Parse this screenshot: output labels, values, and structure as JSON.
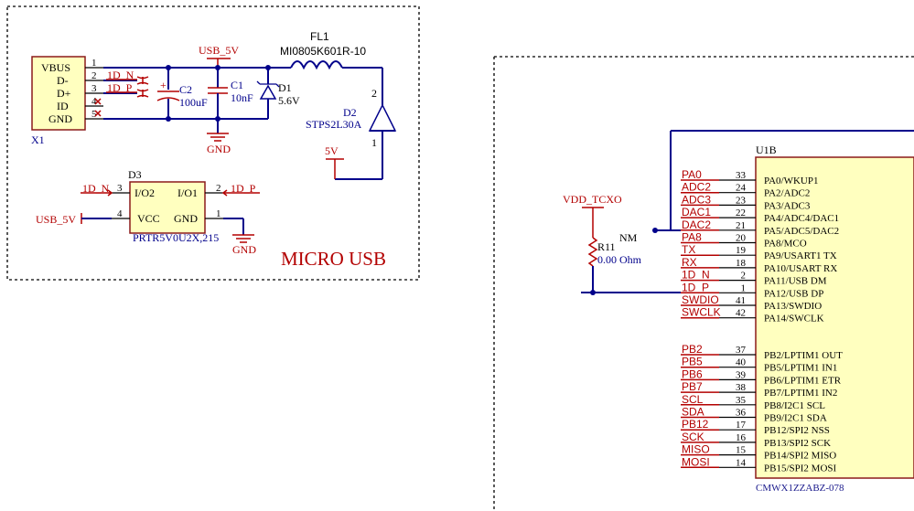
{
  "block_title": "MICRO USB",
  "usb_connector": {
    "ref": "X1",
    "pins": [
      {
        "name": "VBUS",
        "num": "1"
      },
      {
        "name": "D-",
        "num": "2"
      },
      {
        "name": "D+",
        "num": "3"
      },
      {
        "name": "ID",
        "num": "4"
      },
      {
        "name": "GND",
        "num": "5"
      }
    ]
  },
  "net_labels": {
    "usb_5v_top": "USB_5V",
    "usb_5v_left": "USB_5V",
    "net_5v": "5V",
    "d_n": "1D_N",
    "d_p": "1D_P",
    "d3_n": "1D_N",
    "d3_p": "1D_P",
    "gnd_c1": "GND",
    "gnd_d3": "GND",
    "vdd_tcxo": "VDD_TCXO"
  },
  "components": {
    "fl1": {
      "ref": "FL1",
      "value": "MI0805K601R-10"
    },
    "c2": {
      "ref": "C2",
      "value": "100uF",
      "plus": "+"
    },
    "c1": {
      "ref": "C1",
      "value": "10nF"
    },
    "d1": {
      "ref": "D1",
      "value": "5.6V"
    },
    "d2": {
      "ref": "D2",
      "value": "STPS2L30A",
      "pin_top": "2",
      "pin_bottom": "1"
    },
    "d3": {
      "ref": "D3",
      "part": "PRTR5V0U2X,215",
      "pins": [
        {
          "name": "I/O2",
          "num": "3"
        },
        {
          "name": "I/O1",
          "num": "2"
        },
        {
          "name": "VCC",
          "num": "4"
        },
        {
          "name": "GND",
          "num": "1"
        }
      ]
    },
    "r11": {
      "ref": "R11",
      "value": "0.00 Ohm",
      "note": "NM"
    }
  },
  "mcu": {
    "ref": "U1B",
    "part": "CMWX1ZZABZ-078",
    "pins_a": [
      {
        "net": "PA0",
        "num": "33",
        "name": "PA0/WKUP1"
      },
      {
        "net": "ADC2",
        "num": "24",
        "name": "PA2/ADC2"
      },
      {
        "net": "ADC3",
        "num": "23",
        "name": "PA3/ADC3"
      },
      {
        "net": "DAC1",
        "num": "22",
        "name": "PA4/ADC4/DAC1"
      },
      {
        "net": "DAC2",
        "num": "21",
        "name": "PA5/ADC5/DAC2"
      },
      {
        "net": "PA8",
        "num": "20",
        "name": "PA8/MCO"
      },
      {
        "net": "TX",
        "num": "19",
        "name": "PA9/USART1 TX"
      },
      {
        "net": "RX",
        "num": "18",
        "name": "PA10/USART RX"
      },
      {
        "net": "1D_N",
        "num": "2",
        "name": "PA11/USB DM"
      },
      {
        "net": "1D_P",
        "num": "1",
        "name": "PA12/USB DP"
      },
      {
        "net": "SWDIO",
        "num": "41",
        "name": "PA13/SWDIO"
      },
      {
        "net": "SWCLK",
        "num": "42",
        "name": "PA14/SWCLK"
      }
    ],
    "pins_b": [
      {
        "net": "PB2",
        "num": "37",
        "name": "PB2/LPTIM1 OUT"
      },
      {
        "net": "PB5",
        "num": "40",
        "name": "PB5/LPTIM1 IN1"
      },
      {
        "net": "PB6",
        "num": "39",
        "name": "PB6/LPTIM1 ETR"
      },
      {
        "net": "PB7",
        "num": "38",
        "name": "PB7/LPTIM1 IN2"
      },
      {
        "net": "SCL",
        "num": "35",
        "name": "PB8/I2C1 SCL"
      },
      {
        "net": "SDA",
        "num": "36",
        "name": "PB9/I2C1 SDA"
      },
      {
        "net": "PB12",
        "num": "17",
        "name": "PB12/SPI2 NSS"
      },
      {
        "net": "SCK",
        "num": "16",
        "name": "PB13/SPI2 SCK"
      },
      {
        "net": "MISO",
        "num": "15",
        "name": "PB14/SPI2 MISO"
      },
      {
        "net": "MOSI",
        "num": "14",
        "name": "PB15/SPI2 MOSI"
      }
    ]
  }
}
